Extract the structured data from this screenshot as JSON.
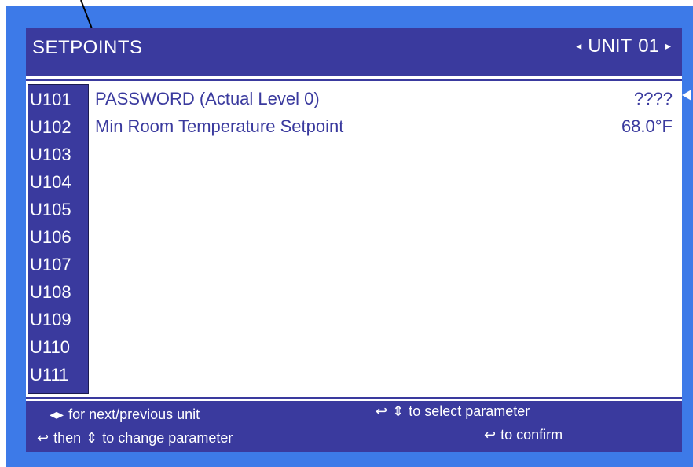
{
  "header": {
    "title": "SETPOINTS",
    "unit_prev_icon": "◂",
    "unit_label": "UNIT",
    "unit_number": "01",
    "unit_next_icon": "▸"
  },
  "rows": [
    {
      "code": "U101",
      "name": "PASSWORD  (Actual Level  0)",
      "value": "????"
    },
    {
      "code": "U102",
      "name": "Min Room Temperature Setpoint",
      "value": "68.0°F"
    },
    {
      "code": "U103",
      "name": "",
      "value": ""
    },
    {
      "code": "U104",
      "name": "",
      "value": ""
    },
    {
      "code": "U105",
      "name": "",
      "value": ""
    },
    {
      "code": "U106",
      "name": "",
      "value": ""
    },
    {
      "code": "U107",
      "name": "",
      "value": ""
    },
    {
      "code": "U108",
      "name": "",
      "value": ""
    },
    {
      "code": "U109",
      "name": "",
      "value": ""
    },
    {
      "code": "U110",
      "name": "",
      "value": ""
    },
    {
      "code": "U111",
      "name": "",
      "value": ""
    }
  ],
  "footer": {
    "line1_left": "for next/previous unit",
    "line2_left_then": "then",
    "line2_left_rest": "to change parameter",
    "line1_right": "to select parameter",
    "line2_right": "to confirm"
  },
  "colors": {
    "frame": "#3d7ae8",
    "screen": "#3a3a9e",
    "text_on_dark": "#ffffff",
    "list_bg": "#ffffff"
  }
}
